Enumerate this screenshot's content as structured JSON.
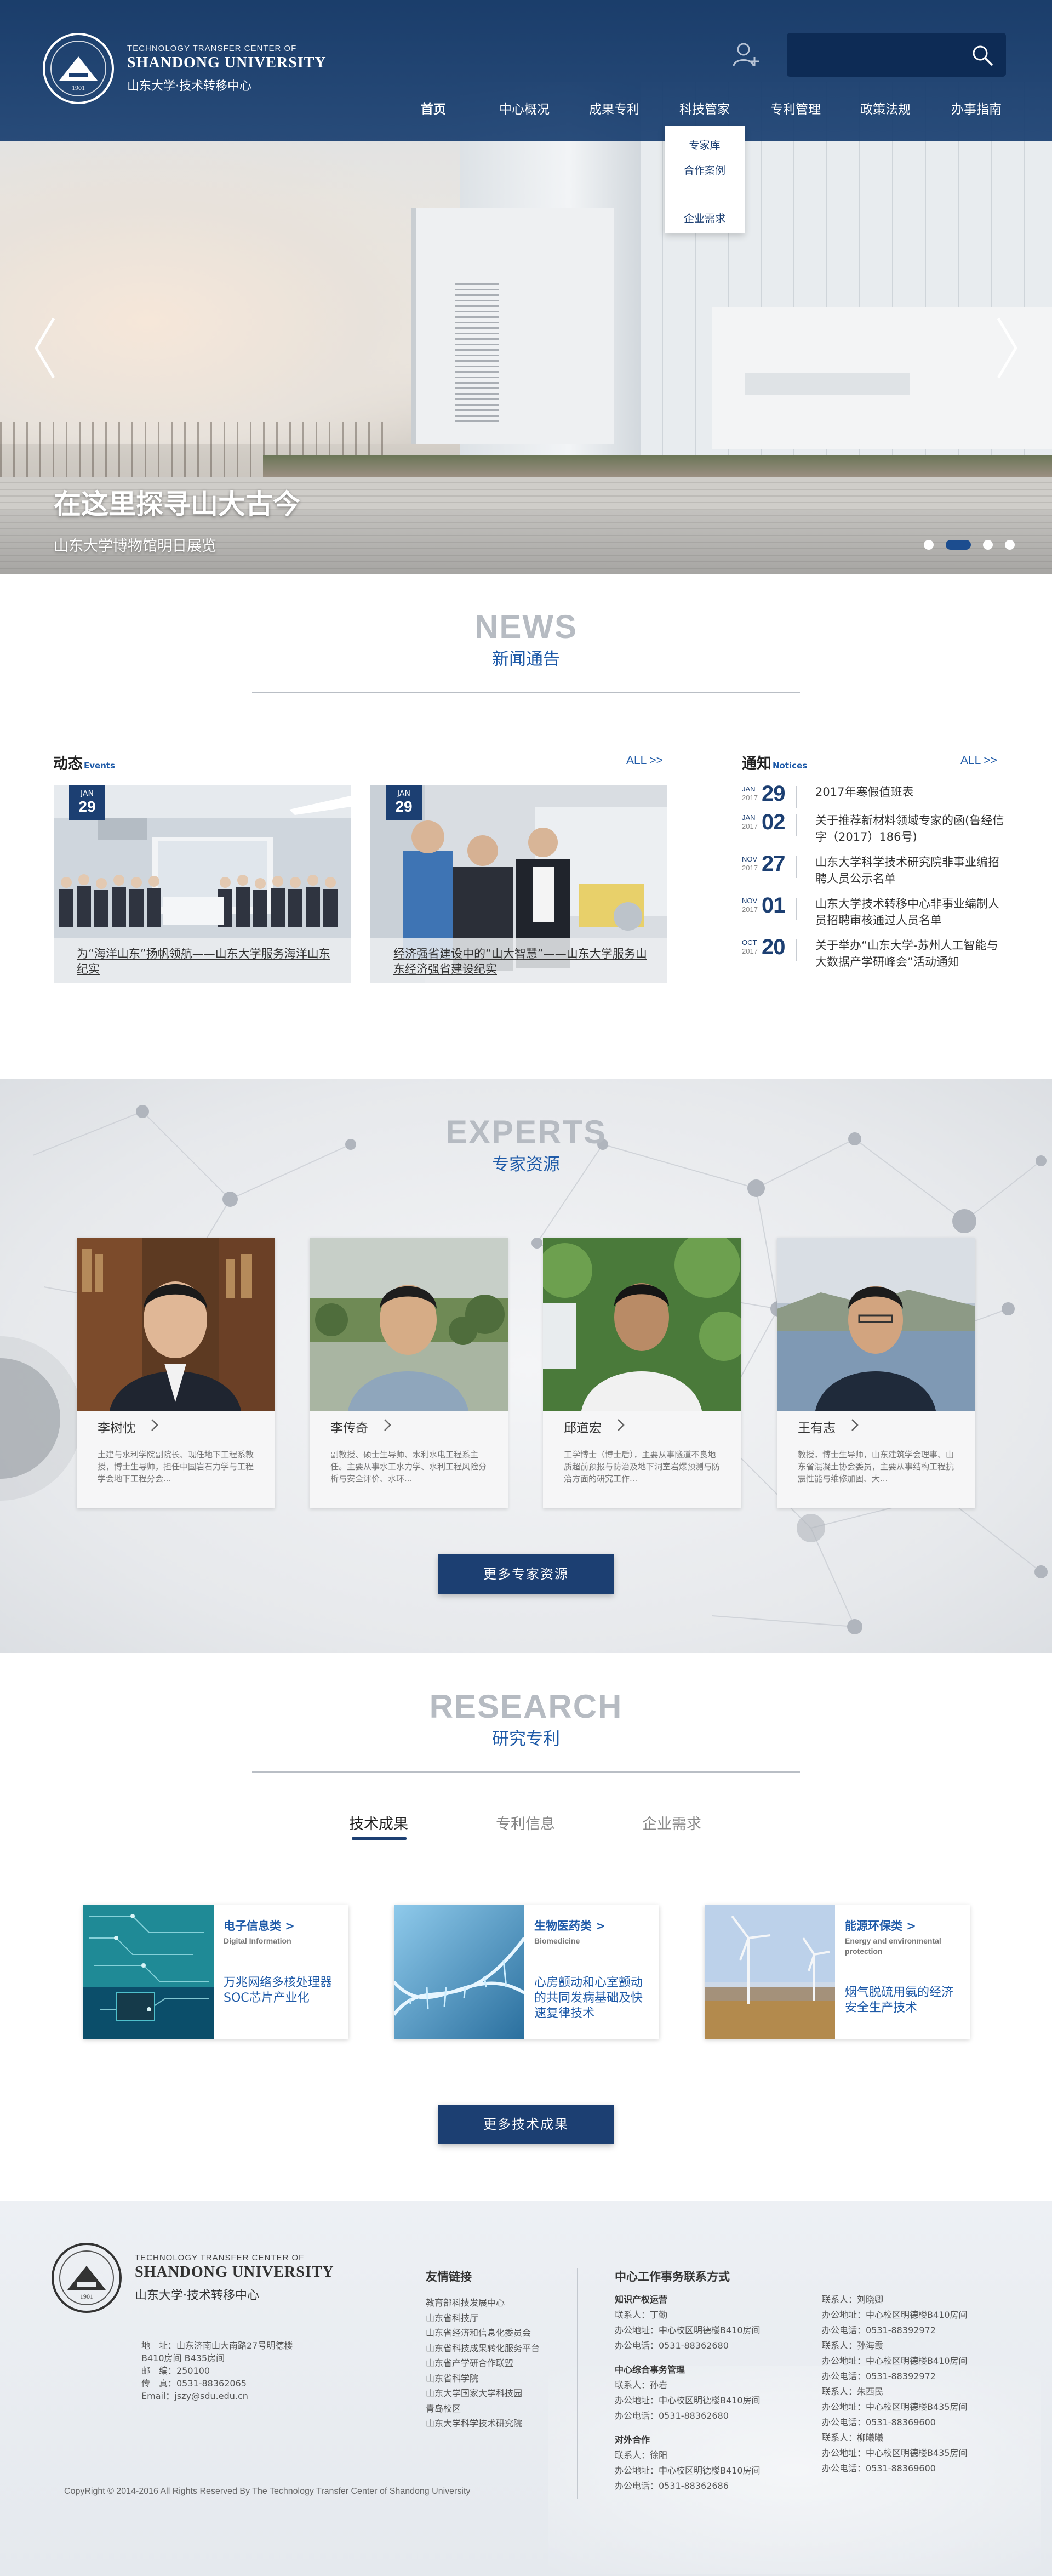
{
  "colors": {
    "brand_navy": "#1c3f72",
    "accent_blue": "#1e5aa8",
    "heading_gray": "#b6bbc2"
  },
  "header": {
    "logo_en_small": "TECHNOLOGY TRANSFER CENTER OF",
    "logo_en_big": "SHANDONG UNIVERSITY",
    "logo_cn": "山东大学·技术转移中心",
    "seal_year": "1901",
    "search_placeholder": "",
    "icons": {
      "user": "user-icon",
      "search": "search-icon"
    }
  },
  "nav": {
    "items": [
      "首页",
      "中心概况",
      "成果专利",
      "科技管家",
      "专利管理",
      "政策法规",
      "办事指南"
    ],
    "active": "首页",
    "dropdown": [
      "专家库",
      "合作案例",
      "企业需求"
    ]
  },
  "hero": {
    "title": "在这里探寻山大古今",
    "subtitle": "山东大学博物馆明日展览",
    "slides_total": 4,
    "current_slide": 2,
    "icons": {
      "prev": "chevron-left-icon",
      "next": "chevron-right-icon"
    }
  },
  "news": {
    "head_en": "NEWS",
    "head_cn": "新闻通告",
    "events_label": "动态",
    "events_label_en": "Events",
    "notices_label": "通知",
    "notices_label_en": "Notices",
    "all_label": "ALL >>",
    "events": [
      {
        "month": "JAN",
        "day": "29",
        "title": "为“海洋山东”扬帆领航——山东大学服务海洋山东纪实"
      },
      {
        "month": "JAN",
        "day": "29",
        "title": "经济强省建设中的“山大智慧”——山东大学服务山东经济强省建设纪实"
      }
    ],
    "notices": [
      {
        "month": "JAN",
        "year": "2017",
        "day": "29",
        "title": "2017年寒假值班表"
      },
      {
        "month": "JAN",
        "year": "2017",
        "day": "02",
        "title": "关于推荐新材料领域专家的函(鲁经信字（2017）186号)"
      },
      {
        "month": "NOV",
        "year": "2017",
        "day": "27",
        "title": "山东大学科学技术研究院非事业编招聘人员公示名单"
      },
      {
        "month": "NOV",
        "year": "2017",
        "day": "01",
        "title": "山东大学技术转移中心非事业编制人员招聘审核通过人员名单"
      },
      {
        "month": "OCT",
        "year": "2017",
        "day": "20",
        "title": "关于举办“山东大学-苏州人工智能与大数据产学研峰会”活动通知"
      }
    ]
  },
  "experts": {
    "head_en": "EXPERTS",
    "head_cn": "专家资源",
    "more_label": "更多专家资源",
    "items": [
      {
        "name": "李树忱",
        "bio": "土建与水利学院副院长、现任地下工程系教授，博士生导师，担任中国岩石力学与工程学会地下工程分会..."
      },
      {
        "name": "李传奇",
        "bio": "副教授、硕士生导师、水利水电工程系主任。主要从事水工水力学、水利工程风险分析与安全评价、水环..."
      },
      {
        "name": "邱道宏",
        "bio": "工学博士（博士后），主要从事隧道不良地质超前预报与防治及地下洞室岩爆预测与防治方面的研究工作..."
      },
      {
        "name": "王有志",
        "bio": "教授，博士生导师，山东建筑学会理事、山东省混凝土协会委员，主要从事结构工程抗震性能与维修加固、大..."
      }
    ]
  },
  "research": {
    "head_en": "RESEARCH",
    "head_cn": "研究专利",
    "tabs": [
      "技术成果",
      "专利信息",
      "企业需求"
    ],
    "active_tab": "技术成果",
    "more_label": "更多技术成果",
    "cards": [
      {
        "title": "电子信息类 >",
        "subtitle": "Digital Information",
        "desc": "万兆网络多核处理器SOC芯片产业化"
      },
      {
        "title": "生物医药类 >",
        "subtitle": "Biomedicine",
        "desc": "心房颤动和心室颤动的共同发病基础及快速复律技术"
      },
      {
        "title": "能源环保类 >",
        "subtitle": "Energy and environmental protection",
        "desc": "烟气脱硫用氨的经济安全生产技术"
      }
    ]
  },
  "footer": {
    "address_lines": [
      "地　址：山东济南山大南路27号明德楼B410房间 B435房间",
      "邮　编：250100",
      "传　真：0531-88362065",
      "Email：jszy@sdu.edu.cn"
    ],
    "links_title": "友情链接",
    "links": [
      "教育部科技发展中心",
      "山东省科技厅",
      "山东省经济和信息化委员会",
      "山东省科技成果转化服务平台",
      "山东省产学研合作联盟",
      "山东省科学院",
      "山东大学国家大学科技园",
      "青岛校区",
      "山东大学科学技术研究院"
    ],
    "contact_title": "中心工作事务联系方式",
    "groups": [
      {
        "title": "知识产权运营",
        "lines": [
          "联系人：丁勤",
          "办公地址：中心校区明德楼B410房间",
          "办公电话：0531-88362680"
        ]
      },
      {
        "title": "中心综合事务管理",
        "lines": [
          "联系人：孙岩",
          "办公地址：中心校区明德楼B410房间",
          "办公电话：0531-88362680"
        ]
      },
      {
        "title": "对外合作",
        "lines": [
          "联系人：徐阳",
          "办公地址：中心校区明德楼B410房间",
          "办公电话：0531-88362686"
        ]
      },
      {
        "title": "",
        "lines": [
          "联系人：刘晓卿",
          "办公地址：中心校区明德楼B410房间",
          "办公电话：0531-88392972",
          "联系人：孙海霞",
          "办公地址：中心校区明德楼B410房间",
          "办公电话：0531-88392972",
          "联系人：朱西民",
          "办公地址：中心校区明德楼B435房间",
          "办公电话：0531-88369600",
          "联系人：柳曦曦",
          "办公地址：中心校区明德楼B435房间",
          "办公电话：0531-88369600"
        ]
      }
    ],
    "copyright": "CopyRight © 2014-2016 All Rights Reserved By The Technology Transfer Center of Shandong University"
  }
}
